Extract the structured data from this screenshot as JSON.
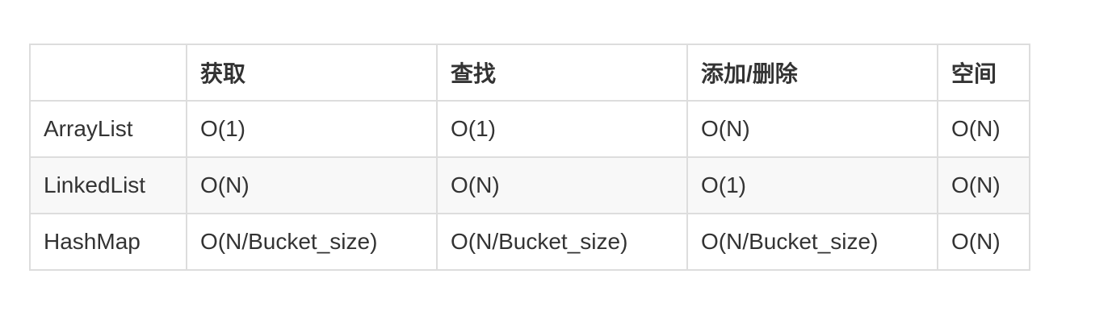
{
  "table": {
    "headers": [
      "",
      "获取",
      "查找",
      "添加/删除",
      "空间"
    ],
    "rows": [
      [
        "ArrayList",
        "O(1)",
        "O(1)",
        "O(N)",
        "O(N)"
      ],
      [
        "LinkedList",
        "O(N)",
        "O(N)",
        "O(1)",
        "O(N)"
      ],
      [
        "HashMap",
        "O(N/Bucket_size)",
        "O(N/Bucket_size)",
        "O(N/Bucket_size)",
        "O(N)"
      ]
    ]
  }
}
